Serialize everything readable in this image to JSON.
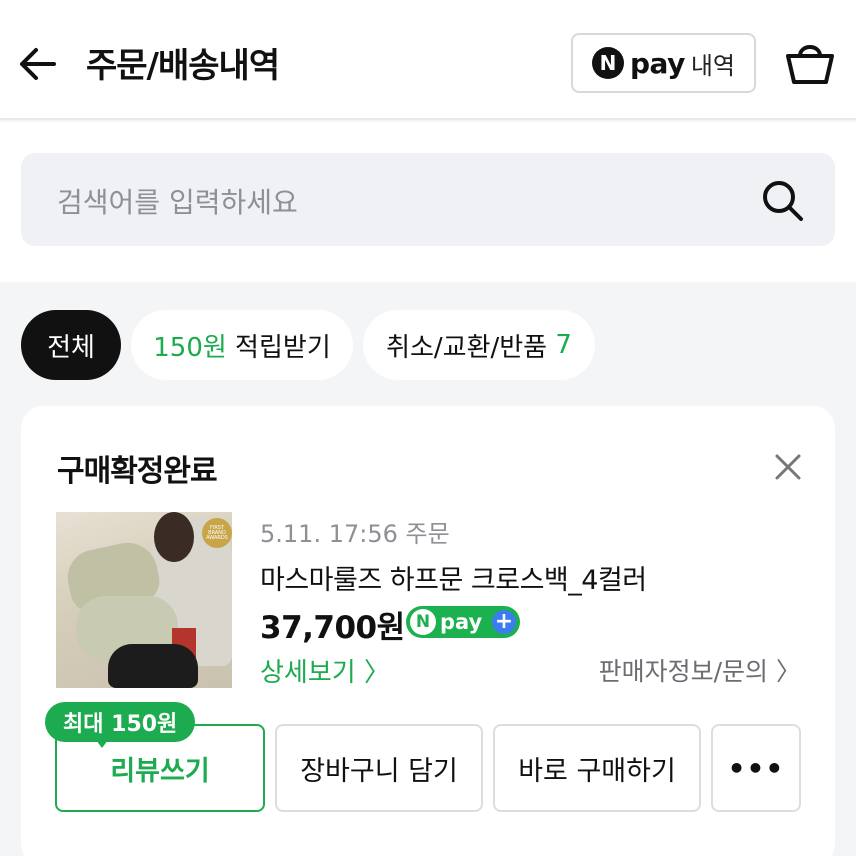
{
  "header": {
    "title": "주문/배송내역",
    "npay_circle": "N",
    "npay_word": "pay",
    "npay_sub": "내역"
  },
  "search": {
    "placeholder": "검색어를 입력하세요"
  },
  "filters": {
    "all": "전체",
    "points_amount": "150원",
    "points_label": " 적립받기",
    "cancel_label": "취소/교환/반품 ",
    "cancel_count": "7"
  },
  "order": {
    "status": "구매확정완료",
    "date": "5.11. 17:56 주문",
    "product": "마스마룰즈 하프문 크로스백_4컬러",
    "price": "37,700원",
    "npay_n": "N",
    "npay_pay": "pay",
    "npay_plus": "+",
    "detail_link": "상세보기 〉",
    "seller_link": "판매자정보/문의 〉",
    "thumb_badge": "FIRST BRAND AWARDS",
    "reward_badge": "최대 150원",
    "buttons": {
      "review": "리뷰쓰기",
      "cart": "장바구니 담기",
      "buy": "바로 구매하기",
      "more": "•••"
    }
  },
  "colors": {
    "accent_green": "#1cab4e",
    "npay_plus_blue": "#3d7cf0"
  }
}
